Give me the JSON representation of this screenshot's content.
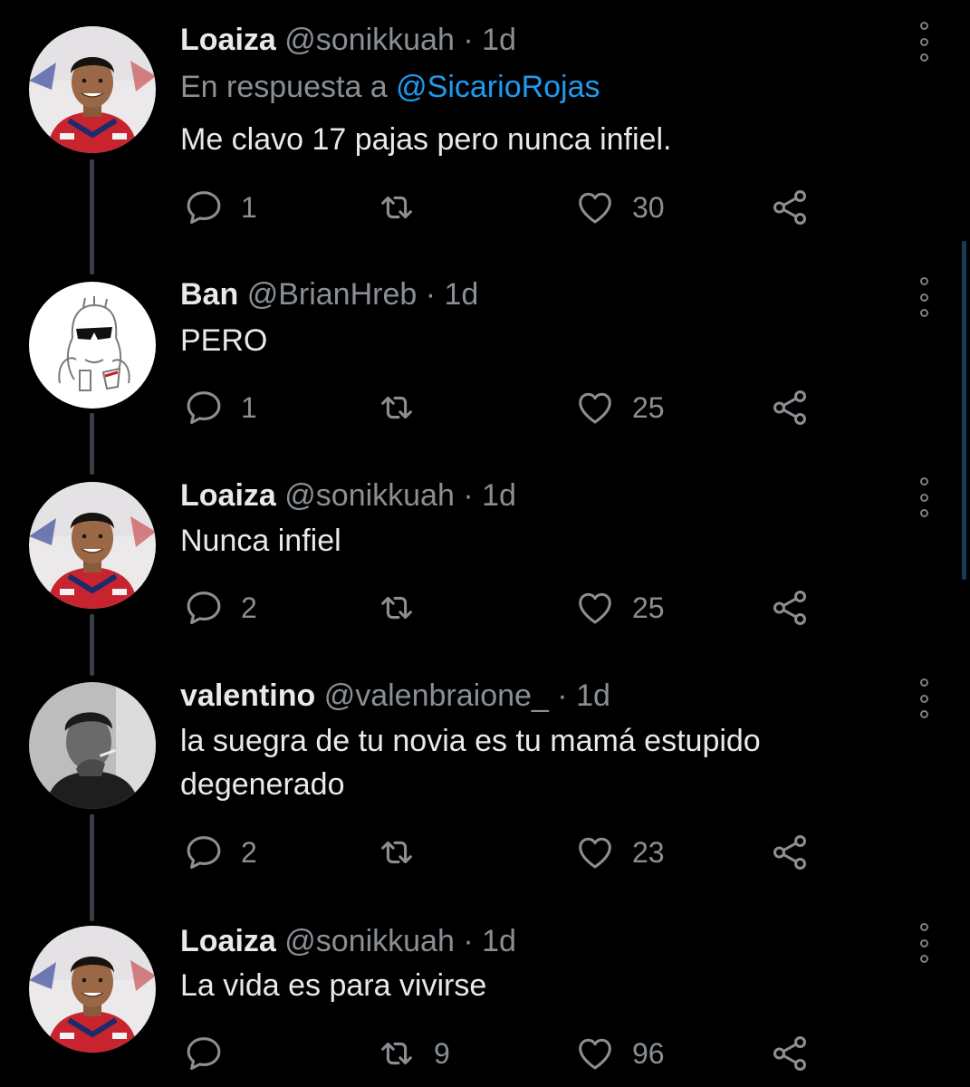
{
  "tweets": [
    {
      "name": "Loaiza",
      "handle": "@sonikkuah",
      "separator": "·",
      "time": "1d",
      "reply_prefix": "En respuesta a ",
      "reply_mention": "@SicarioRojas",
      "text": "Me clavo 17 pajas pero nunca infiel.",
      "counts": {
        "reply": "1",
        "retweet": "",
        "like": "30"
      }
    },
    {
      "name": "Ban",
      "handle": "@BrianHreb",
      "separator": "·",
      "time": "1d",
      "text": "PERO",
      "counts": {
        "reply": "1",
        "retweet": "",
        "like": "25"
      }
    },
    {
      "name": "Loaiza",
      "handle": "@sonikkuah",
      "separator": "·",
      "time": "1d",
      "text": "Nunca infiel",
      "counts": {
        "reply": "2",
        "retweet": "",
        "like": "25"
      }
    },
    {
      "name": "valentino",
      "handle": "@valenbraione_",
      "separator": "·",
      "time": "1d",
      "text": "la suegra de tu novia es tu mamá estupido degenerado",
      "counts": {
        "reply": "2",
        "retweet": "",
        "like": "23"
      }
    },
    {
      "name": "Loaiza",
      "handle": "@sonikkuah",
      "separator": "·",
      "time": "1d",
      "text": "La vida es para vivirse",
      "counts": {
        "reply": "",
        "retweet": "9",
        "like": "96"
      }
    }
  ],
  "icons": {
    "reply": "reply-icon",
    "retweet": "retweet-icon",
    "like": "heart-icon",
    "share": "share-icon",
    "more": "more-options-icon"
  },
  "colors": {
    "background": "#000000",
    "text": "#e7e9ea",
    "secondary": "#8a8f94",
    "link": "#1d9bf0",
    "thread_line": "#3a3f45"
  }
}
